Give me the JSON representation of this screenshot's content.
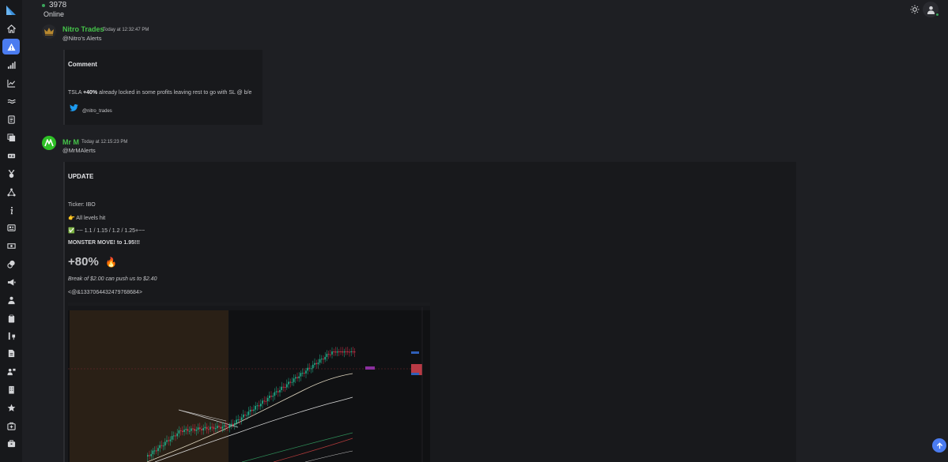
{
  "header": {
    "online_count": "3978",
    "online_label": "Online"
  },
  "sidebar": {
    "items": [
      {
        "icon": "home-icon"
      },
      {
        "icon": "alert-icon",
        "active": true
      },
      {
        "icon": "bar-chart-icon"
      },
      {
        "icon": "line-chart-icon"
      },
      {
        "icon": "wave-icon"
      },
      {
        "icon": "book-icon"
      },
      {
        "icon": "copy-icon"
      },
      {
        "icon": "ticket-icon"
      },
      {
        "icon": "medal-icon"
      },
      {
        "icon": "network-icon"
      },
      {
        "icon": "info-icon"
      },
      {
        "icon": "news-icon"
      },
      {
        "icon": "money-icon"
      },
      {
        "icon": "coins-icon"
      },
      {
        "icon": "megaphone-icon"
      },
      {
        "icon": "user-tie-icon"
      },
      {
        "icon": "clipboard-icon"
      },
      {
        "icon": "tools-icon"
      },
      {
        "icon": "document-icon"
      },
      {
        "icon": "presenter-icon"
      },
      {
        "icon": "building-icon"
      },
      {
        "icon": "star-icon"
      },
      {
        "icon": "medkit-icon"
      },
      {
        "icon": "briefcase-icon"
      }
    ]
  },
  "messages": [
    {
      "author": "Nitro Trades",
      "time": "Today at 12:32:47 PM",
      "handle": "@Nitro's Alerts",
      "embed": {
        "title": "Comment",
        "text_pre": "TSLA ",
        "text_bold": "+40%",
        "text_post": " already locked in some profits leaving rest to go with SL @ b/e",
        "footer": "@nitro_trades"
      }
    },
    {
      "author": "Mr M",
      "time": "Today at 12:15:23 PM",
      "handle": "@MrMAlerts",
      "embed": {
        "title": "UPDATE",
        "ticker": "Ticker: IBO",
        "levels": "👉 All levels hit",
        "targets": "✅ ~~ 1.1 / 1.15 / 1.2 / 1.25+~~",
        "monster": "MONSTER MOVE! to 1.95!!!",
        "big": "+80%",
        "big_emoji": "🔥",
        "break_text": "Break of $2.00 can push us to $2.40",
        "mention": "<@&1337064432479768684>"
      }
    }
  ],
  "colors": {
    "accent": "#4b7cf0",
    "author_green": "#45c44a",
    "online_green": "#3ba55c",
    "background": "#1e1f23"
  }
}
